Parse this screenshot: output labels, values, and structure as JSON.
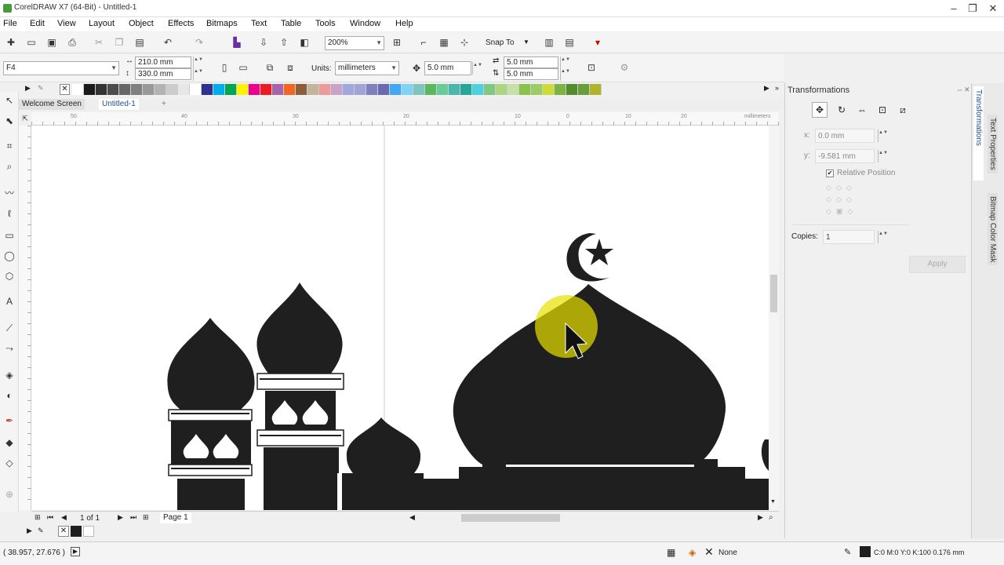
{
  "window": {
    "title": "CorelDRAW X7 (64-Bit) - Untitled-1",
    "minimize": "–",
    "restore": "❐",
    "close": "✕"
  },
  "menu": [
    "File",
    "Edit",
    "View",
    "Layout",
    "Object",
    "Effects",
    "Bitmaps",
    "Text",
    "Table",
    "Tools",
    "Window",
    "Help"
  ],
  "toolbar": {
    "zoom": "200%",
    "snap_to": "Snap To"
  },
  "property_bar": {
    "page_size": "F4",
    "page_width": "210.0 mm",
    "page_height": "330.0 mm",
    "units_label": "Units:",
    "units_value": "millimeters",
    "nudge": "5.0 mm",
    "dup_x": "5.0 mm",
    "dup_y": "5.0 mm"
  },
  "palette": [
    "#ffffff",
    "#1a1a1a",
    "#333333",
    "#4d4d4d",
    "#666666",
    "#808080",
    "#999999",
    "#b3b3b3",
    "#cccccc",
    "#e6e6e6",
    "#ffffff",
    "#2e3192",
    "#00aeef",
    "#00a651",
    "#fff200",
    "#ec008c",
    "#ed1c24",
    "#a864a8",
    "#f26522",
    "#8b5e3c",
    "#c2b59b",
    "#ef9a9a",
    "#c8a2c8",
    "#9fa8da",
    "#a3a3d9",
    "#8080c0",
    "#6a6ab0",
    "#3fa9f5",
    "#7fd3f7",
    "#7dc6c0",
    "#5cb85c",
    "#66cc99",
    "#4db6ac",
    "#26a69a",
    "#4dd0e1",
    "#81c784",
    "#aed581",
    "#c5e1a5",
    "#8bc34a",
    "#9ccc65",
    "#cddc39",
    "#7cb342",
    "#558b2f",
    "#689f38",
    "#afb42b"
  ],
  "doc_tabs": {
    "welcome": "Welcome Screen",
    "active": "Untitled-1",
    "add": "+"
  },
  "ruler": {
    "unit": "millimeters",
    "ticks": [
      "50",
      "40",
      "30",
      "20",
      "10",
      "0",
      "10",
      "20",
      "30",
      "40"
    ]
  },
  "pagebar": {
    "page_count": "1 of 1",
    "page_tab": "Page 1"
  },
  "status": {
    "coords": "( 38.957, 27.676 )",
    "fill_label": "None",
    "outline": "C:0 M:0 Y:0 K:100  0.176 mm"
  },
  "docker": {
    "title": "Transformations",
    "x": "0.0 mm",
    "y": "-9.581 mm",
    "relative_position": "Relative Position",
    "copies_label": "Copies:",
    "copies_value": "1",
    "apply": "Apply"
  },
  "docker_tabs": [
    "Text Properties",
    "Transformations",
    "Bitmap Color Mask"
  ],
  "colors": {
    "mosque": "#1f1f1f",
    "highlight": "#e8e000",
    "active_tab": "#ffffff"
  }
}
